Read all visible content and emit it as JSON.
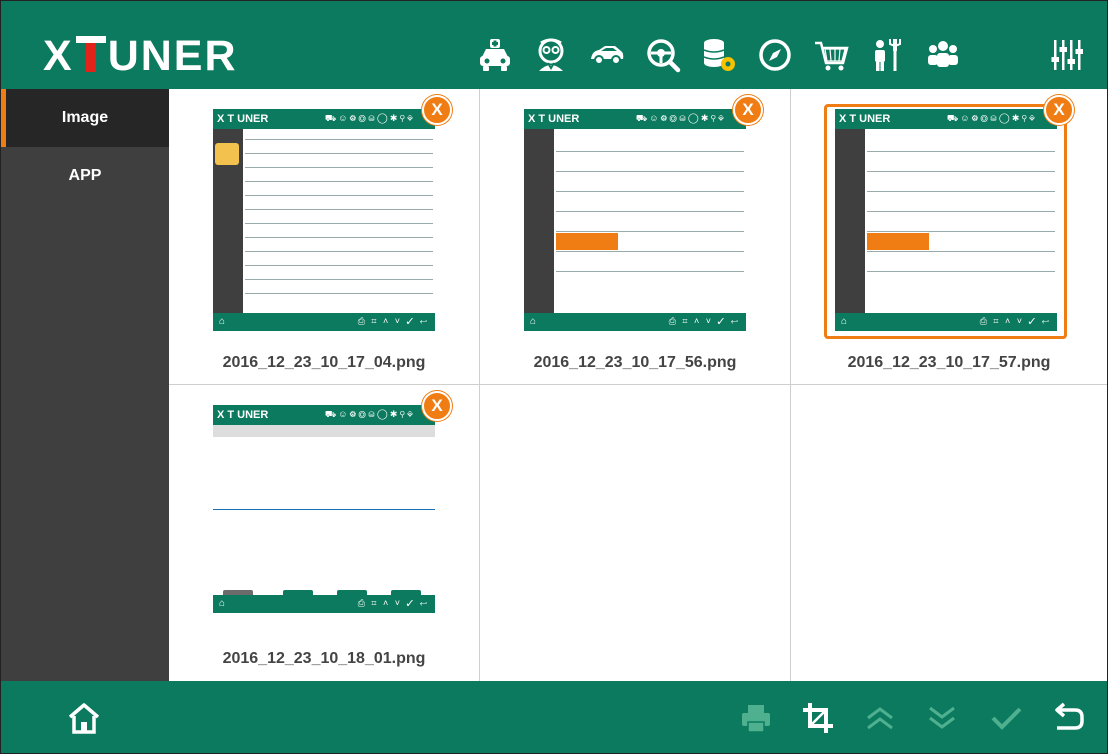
{
  "app": {
    "logo_left": "X",
    "logo_right": "UNER",
    "brand_green": "#0b7a5e",
    "accent_orange": "#f07d14",
    "logo_t_color": "#e2231a"
  },
  "header": {
    "icons": [
      "car-service-icon",
      "doctor-icon",
      "sports-car-icon",
      "steering-search-icon",
      "database-gear-icon",
      "compass-icon",
      "shopping-cart-icon",
      "maintenance-person-icon",
      "group-icon",
      "equalizer-icon"
    ]
  },
  "sidebar": {
    "items": [
      {
        "label": "Image",
        "active": true
      },
      {
        "label": "APP",
        "active": false
      }
    ]
  },
  "gallery": {
    "close_label": "X",
    "items": [
      {
        "filename": "2016_12_23_10_17_04.png",
        "selected": false
      },
      {
        "filename": "2016_12_23_10_17_56.png",
        "selected": false
      },
      {
        "filename": "2016_12_23_10_17_57.png",
        "selected": true
      },
      {
        "filename": "2016_12_23_10_18_01.png",
        "selected": false
      }
    ]
  },
  "footer": {
    "icons": [
      "home-icon",
      "print-icon",
      "crop-icon",
      "chevron-up-double-icon",
      "chevron-down-double-icon",
      "check-icon",
      "back-icon"
    ]
  }
}
